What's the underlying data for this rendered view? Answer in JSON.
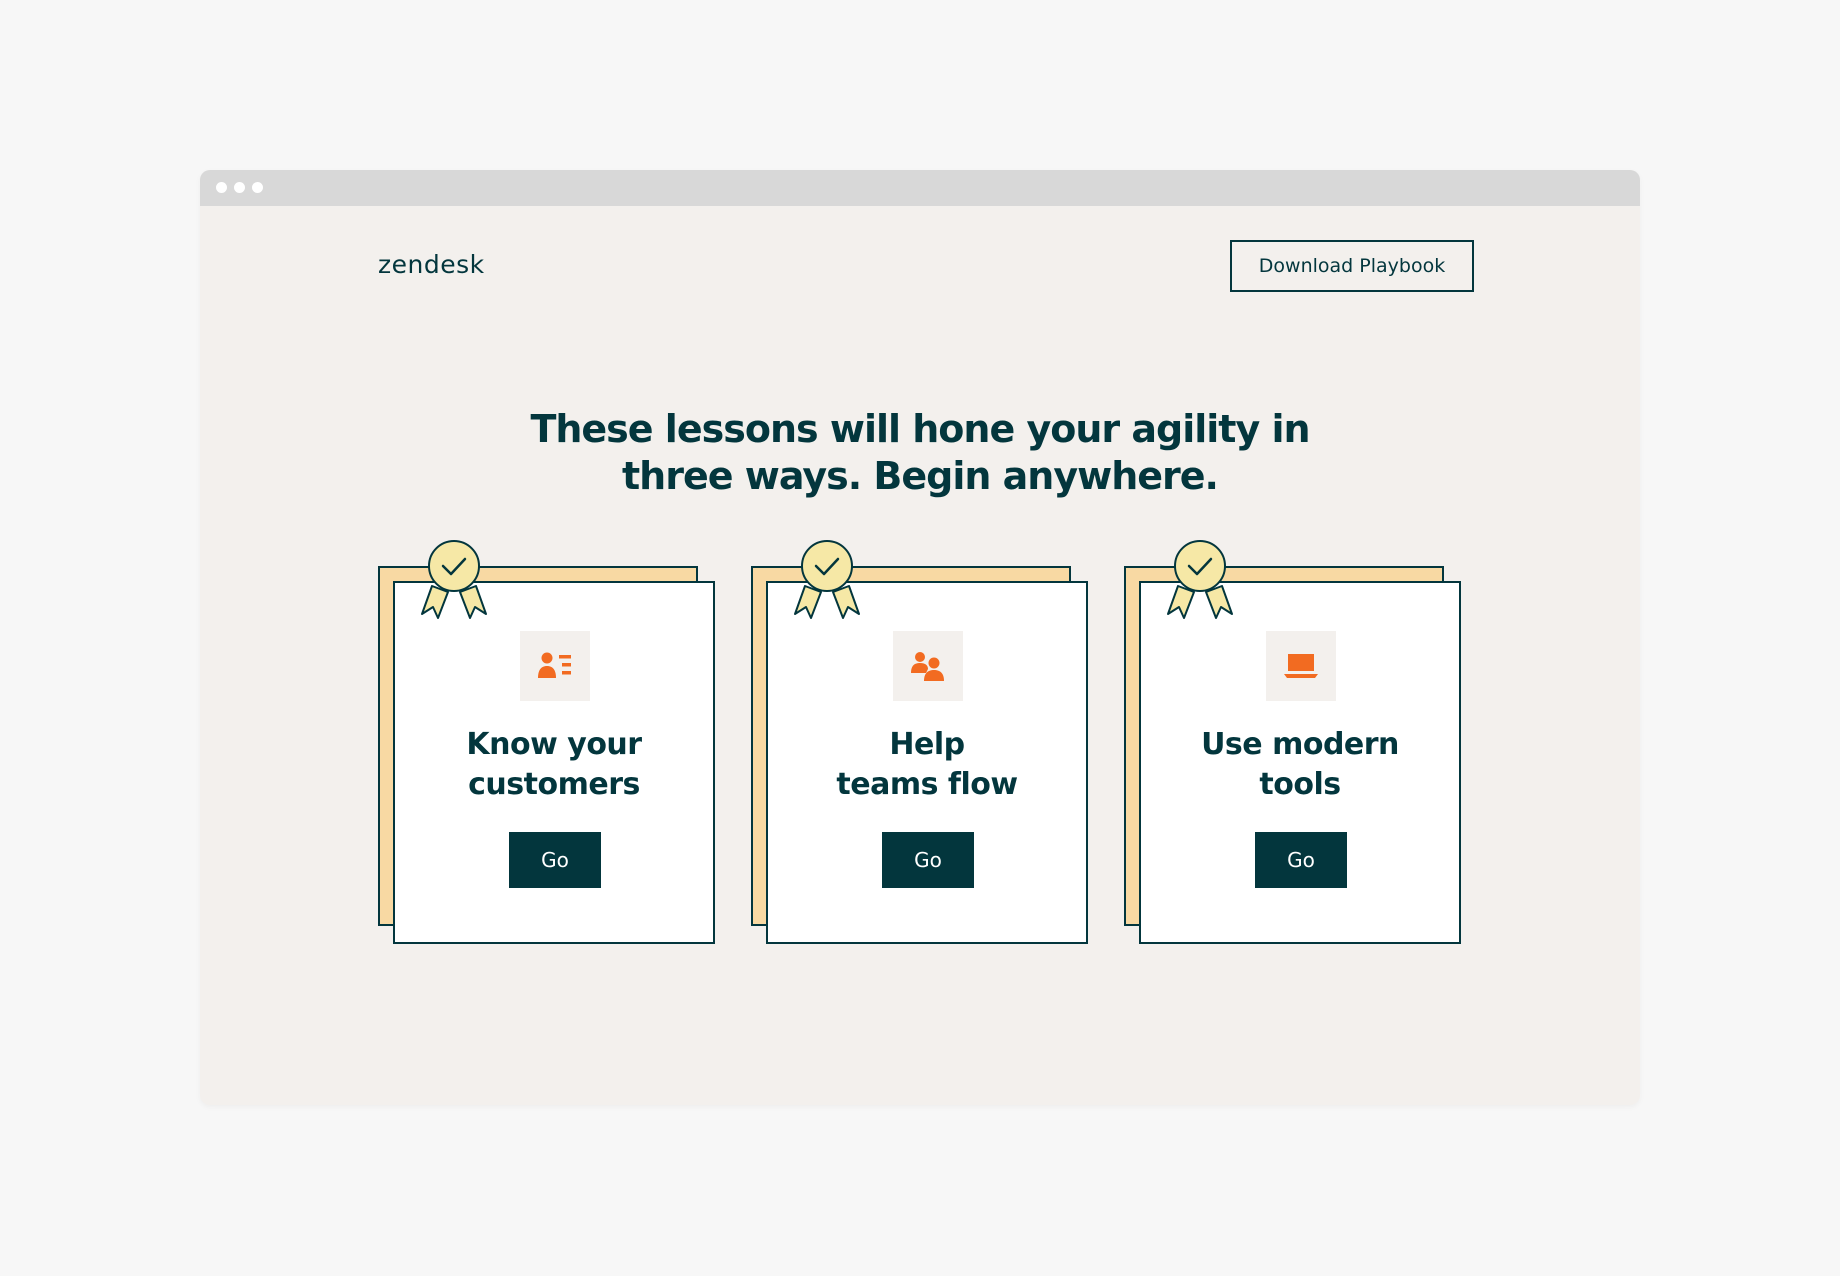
{
  "brand": {
    "logo_text": "zendesk"
  },
  "header": {
    "download_label": "Download Playbook"
  },
  "headline": {
    "line1": "These lessons will hone your agility in",
    "line2": "three ways. Begin anywhere."
  },
  "cards": [
    {
      "title": "Know your\ncustomers",
      "button_label": "Go",
      "icon": "customer-profile-icon",
      "badge_icon": "award-check-icon"
    },
    {
      "title": "Help\nteams flow",
      "button_label": "Go",
      "icon": "team-icon",
      "badge_icon": "award-check-icon"
    },
    {
      "title": "Use modern\ntools",
      "button_label": "Go",
      "icon": "laptop-icon",
      "badge_icon": "award-check-icon"
    }
  ],
  "colors": {
    "page_bg": "#f7f7f7",
    "browser_bg": "#f3f0ed",
    "browser_bar": "#d8d8d8",
    "primary": "#03363d",
    "accent": "#f26b21",
    "card_back": "#f8d9a3",
    "badge": "#f6e8a6"
  }
}
